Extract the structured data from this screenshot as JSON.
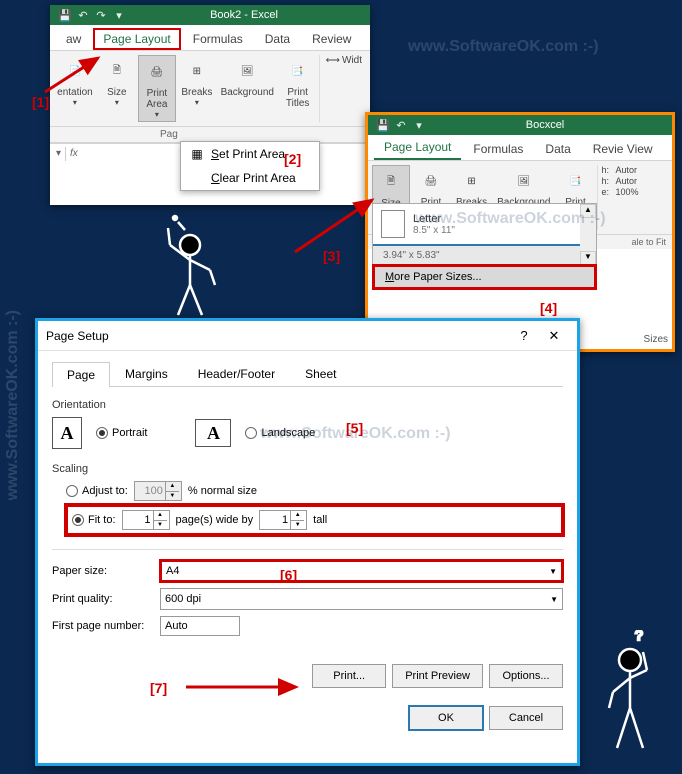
{
  "watermark": "www.SoftwareOK.com :-)",
  "callouts": [
    "[1]",
    "[2]",
    "[3]",
    "[4]",
    "[5]",
    "[6]",
    "[7]"
  ],
  "win1": {
    "title": "Book2 - Excel",
    "tabs": {
      "draw": "aw",
      "pagelayout": "Page Layout",
      "formulas": "Formulas",
      "data": "Data",
      "review": "Review"
    },
    "ribbon": {
      "orientation": "entation",
      "size": "Size",
      "printarea": "Print\nArea",
      "breaks": "Breaks",
      "background": "Background",
      "printtitles": "Print\nTitles",
      "width": "Widt"
    },
    "group_label": "Pag",
    "menu": {
      "set": "Set Print Area",
      "clear": "Clear Print Area"
    },
    "fx": "fx"
  },
  "win2": {
    "title": "Bocxcel",
    "tabs": {
      "pagelayout": "Page Layout",
      "formulas": "Formulas",
      "data": "Data",
      "review": "Revie View"
    },
    "ribbon": {
      "size": "Size",
      "printarea": "Print\nArea",
      "breaks": "Breaks",
      "background": "Background",
      "printtitles": "Print\nTitles"
    },
    "side": {
      "height_label": "h:",
      "height": "Autor",
      "width_label": "h:",
      "width": "Autor",
      "scale_label": "e:",
      "scale": "100%",
      "fit": "ale to Fit"
    },
    "paper": {
      "name": "Letter",
      "dims": "8.5\" x 11\""
    },
    "current": "3.94\" x 5.83\"",
    "more": "More Paper Sizes...",
    "sizes": "Sizes"
  },
  "dlg": {
    "title": "Page Setup",
    "tabs": {
      "page": "Page",
      "margins": "Margins",
      "header": "Header/Footer",
      "sheet": "Sheet"
    },
    "orientation": {
      "label": "Orientation",
      "portrait": "Portrait",
      "landscape": "Landscape"
    },
    "scaling": {
      "label": "Scaling",
      "adjust": "Adjust to:",
      "adjust_val": "100",
      "adjust_unit": "% normal size",
      "fit": "Fit to:",
      "fit_wide": "1",
      "fit_mid": "page(s) wide by",
      "fit_tall": "1",
      "tall": "tall"
    },
    "paper": {
      "label": "Paper size:",
      "value": "A4"
    },
    "quality": {
      "label": "Print quality:",
      "value": "600 dpi"
    },
    "first": {
      "label": "First page number:",
      "value": "Auto"
    },
    "buttons": {
      "print": "Print...",
      "preview": "Print Preview",
      "options": "Options...",
      "ok": "OK",
      "cancel": "Cancel"
    }
  }
}
